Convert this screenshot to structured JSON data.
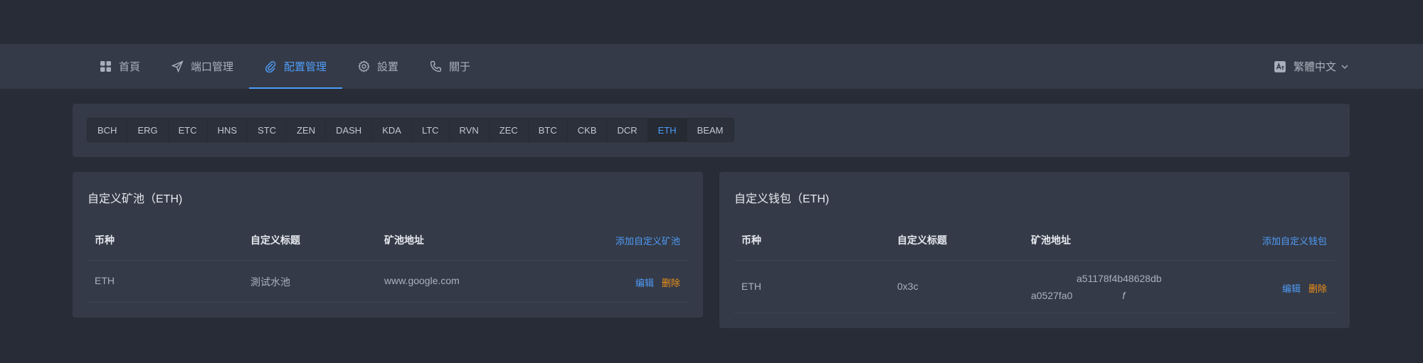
{
  "nav": {
    "items": [
      {
        "label": "首頁",
        "icon": "grid-icon"
      },
      {
        "label": "端口管理",
        "icon": "send-icon"
      },
      {
        "label": "配置管理",
        "icon": "paperclip-icon"
      },
      {
        "label": "設置",
        "icon": "gear-icon"
      },
      {
        "label": "關于",
        "icon": "phone-icon"
      }
    ],
    "active_index": 2
  },
  "language": {
    "label": "繁體中文",
    "icon": "translate-icon"
  },
  "coins": [
    "BCH",
    "ERG",
    "ETC",
    "HNS",
    "STC",
    "ZEN",
    "DASH",
    "KDA",
    "LTC",
    "RVN",
    "ZEC",
    "BTC",
    "CKB",
    "DCR",
    "ETH",
    "BEAM"
  ],
  "active_coin": "ETH",
  "pool_card": {
    "title": "自定义矿池（ETH)",
    "headers": {
      "coin": "币种",
      "custom_title": "自定义标题",
      "address": "矿池地址"
    },
    "add_label": "添加自定义矿池",
    "rows": [
      {
        "coin": "ETH",
        "custom_title": "測试水池",
        "address": "www.google.com",
        "edit": "编辑",
        "delete": "删除"
      }
    ]
  },
  "wallet_card": {
    "title": "自定义钱包（ETH)",
    "headers": {
      "coin": "币种",
      "custom_title": "自定义标题",
      "address": "矿池地址"
    },
    "add_label": "添加自定义钱包",
    "rows": [
      {
        "coin": "ETH",
        "custom_title": "0x3c",
        "address_line1": "a51178f4b48628db",
        "address_line2_start": "a0527fa0",
        "address_line2_end": "f",
        "edit": "编辑",
        "delete": "删除"
      }
    ]
  },
  "colors": {
    "accent": "#4f9cf7",
    "danger": "#f0901a",
    "background": "#272c36",
    "panel": "#343a47"
  }
}
